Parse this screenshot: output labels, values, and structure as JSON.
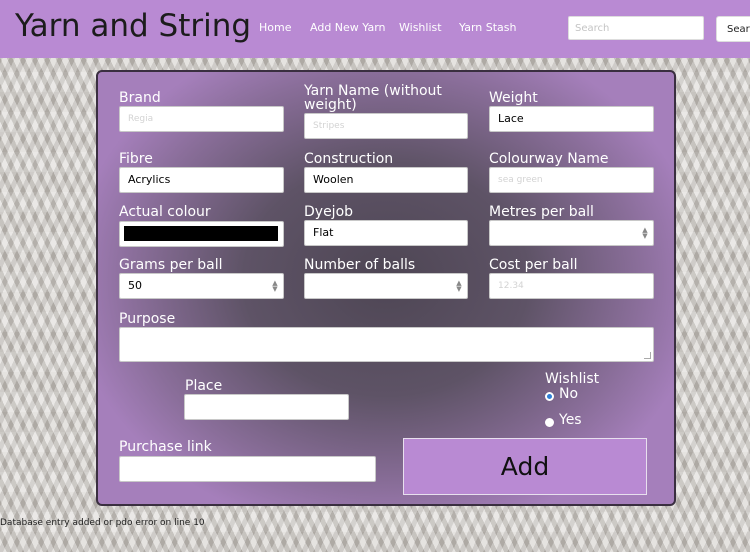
{
  "navbar": {
    "brand": "Yarn and String",
    "links": [
      "Home",
      "Add New Yarn",
      "Wishlist",
      "Yarn Stash"
    ],
    "search_placeholder": "Search",
    "search_button": "Search",
    "background": "#b98ad3"
  },
  "form": {
    "brand": {
      "label": "Brand",
      "placeholder": "Regia",
      "value": ""
    },
    "yarn_name": {
      "label": "Yarn Name (without weight)",
      "placeholder": "Stripes",
      "value": ""
    },
    "weight": {
      "label": "Weight",
      "value": "Lace"
    },
    "fibre": {
      "label": "Fibre",
      "value": "Acrylics"
    },
    "construction": {
      "label": "Construction",
      "value": "Woolen"
    },
    "colourway": {
      "label": "Colourway Name",
      "placeholder": "sea green",
      "value": ""
    },
    "actual_colour": {
      "label": "Actual colour",
      "value": "#000000"
    },
    "dyejob": {
      "label": "Dyejob",
      "value": "Flat"
    },
    "metres_per_ball": {
      "label": "Metres per ball",
      "value": ""
    },
    "grams_per_ball": {
      "label": "Grams per ball",
      "value": "50"
    },
    "number_of_balls": {
      "label": "Number of balls",
      "value": ""
    },
    "cost_per_ball": {
      "label": "Cost per ball",
      "placeholder": "12.34",
      "value": ""
    },
    "purpose": {
      "label": "Purpose",
      "value": ""
    },
    "place": {
      "label": "Place",
      "value": ""
    },
    "wishlist": {
      "label": "Wishlist",
      "options": [
        "No",
        "Yes"
      ],
      "selected": "No"
    },
    "purchase_link": {
      "label": "Purchase link",
      "value": ""
    },
    "submit_label": "Add"
  },
  "status_message": "Database entry added or pdo error on line 10"
}
